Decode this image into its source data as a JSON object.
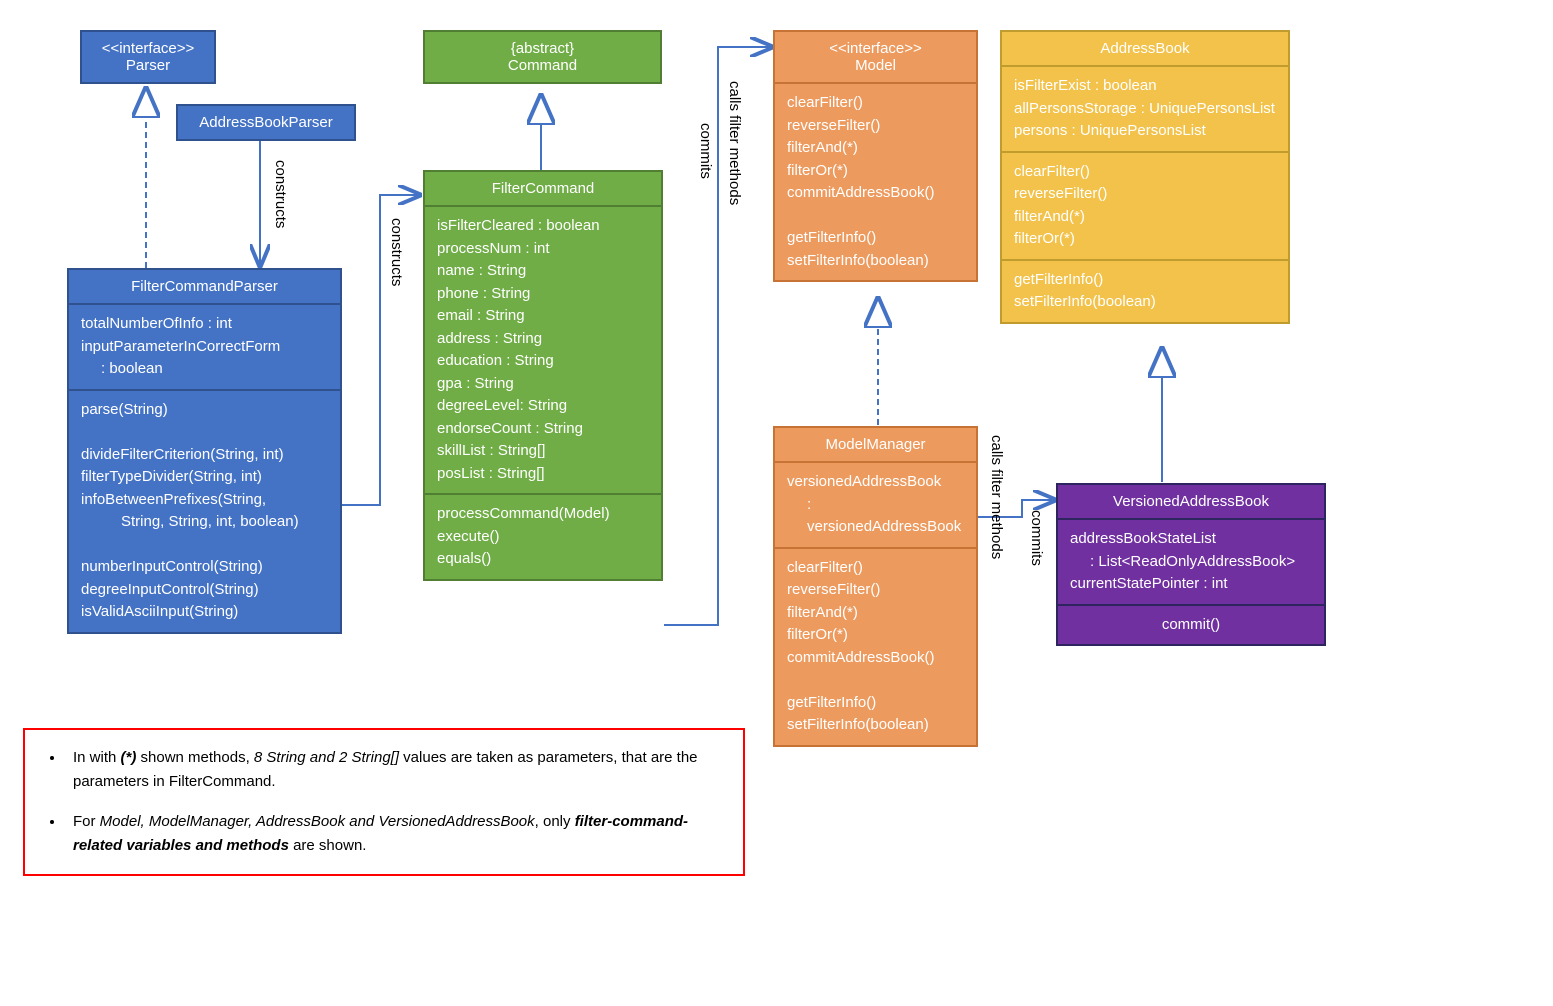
{
  "parser": {
    "stereotype": "<<interface>>",
    "name": "Parser"
  },
  "addressBookParser": {
    "name": "AddressBookParser"
  },
  "filterCommandParser": {
    "name": "FilterCommandParser",
    "attrs": [
      "totalNumberOfInfo : int",
      "inputParameterInCorrectForm",
      ": boolean"
    ],
    "ops1": [
      "parse(String)"
    ],
    "ops2": [
      "divideFilterCriterion(String, int)",
      "filterTypeDivider(String, int)",
      "infoBetweenPrefixes(String,",
      "String, String, int, boolean)"
    ],
    "ops3": [
      "numberInputControl(String)",
      "degreeInputControl(String)",
      "isValidAsciiInput(String)"
    ]
  },
  "command": {
    "stereotype": "{abstract}",
    "name": "Command"
  },
  "filterCommand": {
    "name": "FilterCommand",
    "attrs": [
      "isFilterCleared : boolean",
      "processNum : int",
      "name : String",
      "phone : String",
      "email : String",
      "address : String",
      "education : String",
      "gpa : String",
      "degreeLevel: String",
      "endorseCount : String",
      "skillList : String[]",
      "posList : String[]"
    ],
    "ops": [
      "processCommand(Model)",
      "execute()",
      "equals()"
    ]
  },
  "model": {
    "stereotype": "<<interface>>",
    "name": "Model",
    "ops1": [
      "clearFilter()",
      "reverseFilter()",
      "filterAnd(*)",
      "filterOr(*)",
      "commitAddressBook()"
    ],
    "ops2": [
      "getFilterInfo()",
      "setFilterInfo(boolean)"
    ]
  },
  "modelManager": {
    "name": "ModelManager",
    "attrs": [
      "versionedAddressBook",
      ": versionedAddressBook"
    ],
    "ops1": [
      "clearFilter()",
      "reverseFilter()",
      "filterAnd(*)",
      "filterOr(*)",
      "commitAddressBook()"
    ],
    "ops2": [
      "getFilterInfo()",
      "setFilterInfo(boolean)"
    ]
  },
  "addressBook": {
    "name": "AddressBook",
    "attrs": [
      "isFilterExist : boolean",
      "allPersonsStorage : UniquePersonsList",
      "persons : UniquePersonsList"
    ],
    "ops1": [
      "clearFilter()",
      "reverseFilter()",
      "filterAnd(*)",
      "filterOr(*)"
    ],
    "ops2": [
      "getFilterInfo()",
      "setFilterInfo(boolean)"
    ]
  },
  "versionedAddressBook": {
    "name": "VersionedAddressBook",
    "attrs": [
      "addressBookStateList",
      ": List<ReadOnlyAddressBook>",
      "currentStatePointer : int"
    ],
    "ops": [
      "commit()"
    ]
  },
  "note": {
    "line1a": "In with ",
    "line1b": "(*)",
    "line1c": " shown methods, ",
    "line1d": "8 String and 2 String[]",
    "line1e": " values are taken as parameters, that are the parameters in FilterCommand.",
    "line2a": "For ",
    "line2b": "Model, ModelManager, AddressBook and VersionedAddressBook",
    "line2c": ", only ",
    "line2d": "filter-command-related variables and methods",
    "line2e": " are shown."
  },
  "labels": {
    "constructs": "constructs",
    "callsFilter": "calls filter methods",
    "commits": "commits"
  }
}
